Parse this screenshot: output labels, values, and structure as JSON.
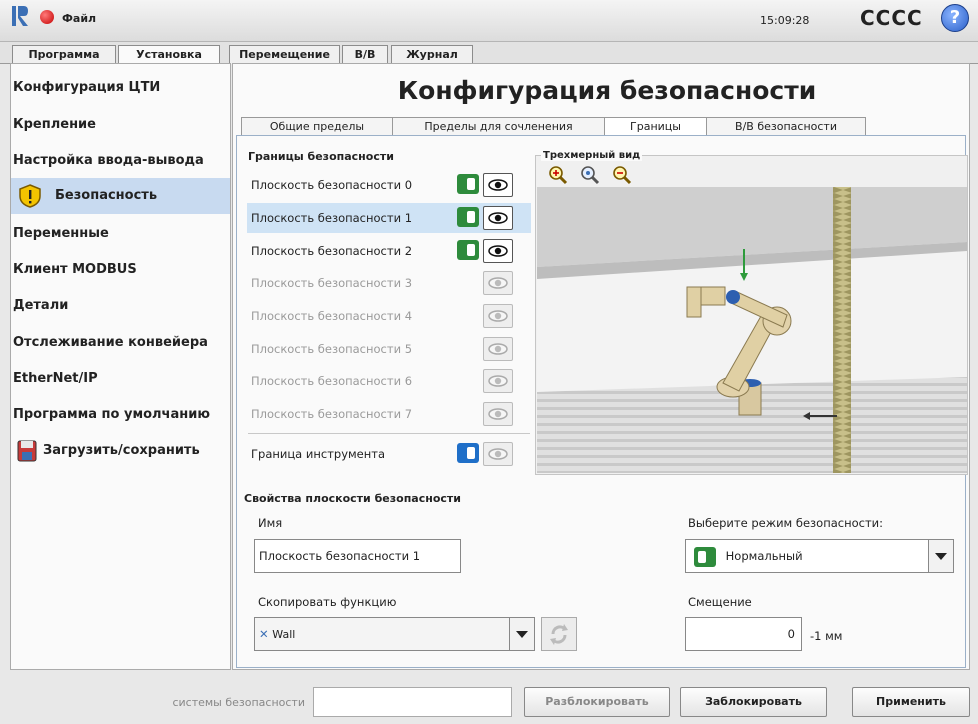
{
  "header": {
    "menu_label": "Файл",
    "time": "15:09:28",
    "robot_name": "CCCC",
    "help_symbol": "?"
  },
  "top_tabs": [
    "Программа",
    "Установка",
    "Перемещение",
    "В/В",
    "Журнал"
  ],
  "sidebar": {
    "items": [
      {
        "label": "Конфигурация ЦТИ"
      },
      {
        "label": "Крепление"
      },
      {
        "label": "Настройка ввода-вывода"
      },
      {
        "label": "Безопасность",
        "icon": "warning-shield-icon"
      },
      {
        "label": "Переменные"
      },
      {
        "label": "Клиент MODBUS"
      },
      {
        "label": "Детали"
      },
      {
        "label": "Отслеживание конвейера"
      },
      {
        "label": "EtherNet/IP"
      },
      {
        "label": "Программа по умолчанию"
      },
      {
        "label": "Загрузить/сохранить",
        "icon": "save-icon"
      }
    ]
  },
  "page_title": "Конфигурация безопасности",
  "sub_tabs": [
    "Общие пределы",
    "Пределы для сочленения",
    "Границы",
    "В/В безопасности"
  ],
  "boundaries": {
    "heading": "Границы безопасности",
    "planes": [
      {
        "label": "Плоскость безопасности 0",
        "state": "normal"
      },
      {
        "label": "Плоскость безопасности 1",
        "state": "normal"
      },
      {
        "label": "Плоскость безопасности 2",
        "state": "trigger"
      },
      {
        "label": "Плоскость безопасности 3",
        "state": "disabled"
      },
      {
        "label": "Плоскость безопасности 4",
        "state": "disabled"
      },
      {
        "label": "Плоскость безопасности 5",
        "state": "disabled"
      },
      {
        "label": "Плоскость безопасности 6",
        "state": "disabled"
      },
      {
        "label": "Плоскость безопасности 7",
        "state": "disabled"
      }
    ],
    "tool_boundary_label": "Граница инструмента"
  },
  "view3d": {
    "label": "Трехмерный вид",
    "zoom_icons": [
      "zoom-in-icon",
      "zoom-reset-icon",
      "zoom-out-icon"
    ]
  },
  "properties": {
    "heading": "Свойства плоскости безопасности",
    "name_label": "Имя",
    "name_value": "Плоскость безопасности 1",
    "mode_label": "Выберите режим безопасности:",
    "mode_value": "Нормальный",
    "copy_label": "Скопировать функцию",
    "copy_value": "Wall",
    "offset_label": "Смещение",
    "offset_value": "0",
    "offset_unit": "-1 мм"
  },
  "footer": {
    "password_label": "системы безопасности",
    "unlock_label": "Разблокировать",
    "lock_label": "Заблокировать",
    "apply_label": "Применить"
  },
  "colors": {
    "normal_mode": "#2e8b3c",
    "tool_mode": "#1f6fc8",
    "selection": "#cfe3f5"
  }
}
